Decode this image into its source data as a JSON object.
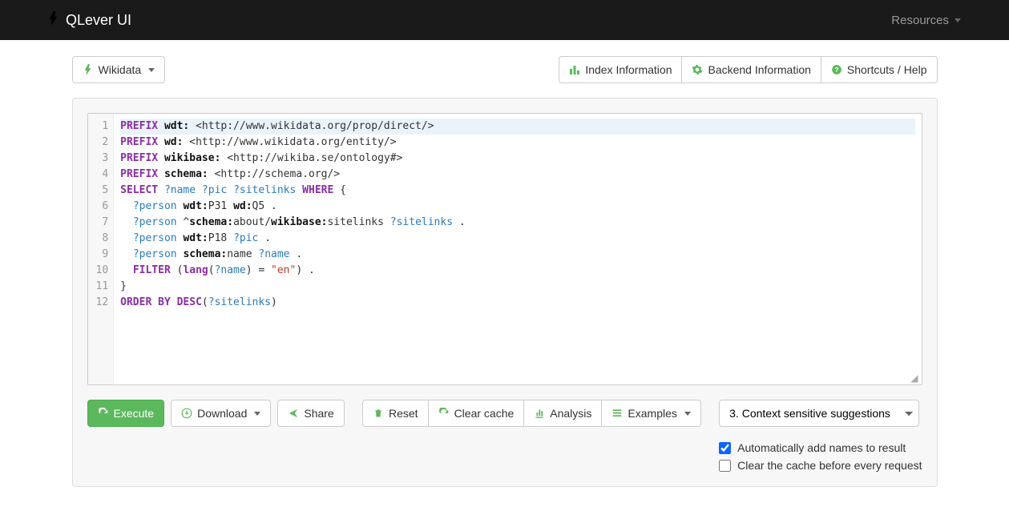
{
  "nav": {
    "brand": "QLever UI",
    "resources": "Resources"
  },
  "toolbar": {
    "dataset_label": "Wikidata",
    "index_info": "Index Information",
    "backend_info": "Backend Information",
    "shortcuts": "Shortcuts / Help"
  },
  "code": {
    "lines": [
      [
        {
          "t": "kw",
          "v": "PREFIX"
        },
        {
          "t": "txt",
          "v": " "
        },
        {
          "t": "pfx",
          "v": "wdt:"
        },
        {
          "t": "txt",
          "v": " <http://www.wikidata.org/prop/direct/>"
        }
      ],
      [
        {
          "t": "kw",
          "v": "PREFIX"
        },
        {
          "t": "txt",
          "v": " "
        },
        {
          "t": "pfx",
          "v": "wd:"
        },
        {
          "t": "txt",
          "v": " <http://www.wikidata.org/entity/>"
        }
      ],
      [
        {
          "t": "kw",
          "v": "PREFIX"
        },
        {
          "t": "txt",
          "v": " "
        },
        {
          "t": "pfx",
          "v": "wikibase:"
        },
        {
          "t": "txt",
          "v": " <http://wikiba.se/ontology#>"
        }
      ],
      [
        {
          "t": "kw",
          "v": "PREFIX"
        },
        {
          "t": "txt",
          "v": " "
        },
        {
          "t": "pfx",
          "v": "schema:"
        },
        {
          "t": "txt",
          "v": " <http://schema.org/>"
        }
      ],
      [
        {
          "t": "kw",
          "v": "SELECT"
        },
        {
          "t": "txt",
          "v": " "
        },
        {
          "t": "var",
          "v": "?name"
        },
        {
          "t": "txt",
          "v": " "
        },
        {
          "t": "var",
          "v": "?pic"
        },
        {
          "t": "txt",
          "v": " "
        },
        {
          "t": "var",
          "v": "?sitelinks"
        },
        {
          "t": "txt",
          "v": " "
        },
        {
          "t": "kw",
          "v": "WHERE"
        },
        {
          "t": "txt",
          "v": " {"
        }
      ],
      [
        {
          "t": "txt",
          "v": "  "
        },
        {
          "t": "var",
          "v": "?person"
        },
        {
          "t": "txt",
          "v": " "
        },
        {
          "t": "pfx",
          "v": "wdt:"
        },
        {
          "t": "txt",
          "v": "P31 "
        },
        {
          "t": "pfx",
          "v": "wd:"
        },
        {
          "t": "txt",
          "v": "Q5 ."
        }
      ],
      [
        {
          "t": "txt",
          "v": "  "
        },
        {
          "t": "var",
          "v": "?person"
        },
        {
          "t": "txt",
          "v": " ^"
        },
        {
          "t": "pfx",
          "v": "schema:"
        },
        {
          "t": "txt",
          "v": "about/"
        },
        {
          "t": "pfx",
          "v": "wikibase:"
        },
        {
          "t": "txt",
          "v": "sitelinks "
        },
        {
          "t": "var",
          "v": "?sitelinks"
        },
        {
          "t": "txt",
          "v": " ."
        }
      ],
      [
        {
          "t": "txt",
          "v": "  "
        },
        {
          "t": "var",
          "v": "?person"
        },
        {
          "t": "txt",
          "v": " "
        },
        {
          "t": "pfx",
          "v": "wdt:"
        },
        {
          "t": "txt",
          "v": "P18 "
        },
        {
          "t": "var",
          "v": "?pic"
        },
        {
          "t": "txt",
          "v": " ."
        }
      ],
      [
        {
          "t": "txt",
          "v": "  "
        },
        {
          "t": "var",
          "v": "?person"
        },
        {
          "t": "txt",
          "v": " "
        },
        {
          "t": "pfx",
          "v": "schema:"
        },
        {
          "t": "txt",
          "v": "name "
        },
        {
          "t": "var",
          "v": "?name"
        },
        {
          "t": "txt",
          "v": " ."
        }
      ],
      [
        {
          "t": "txt",
          "v": "  "
        },
        {
          "t": "kw",
          "v": "FILTER"
        },
        {
          "t": "txt",
          "v": " ("
        },
        {
          "t": "fn",
          "v": "lang"
        },
        {
          "t": "txt",
          "v": "("
        },
        {
          "t": "var",
          "v": "?name"
        },
        {
          "t": "txt",
          "v": ") = "
        },
        {
          "t": "str",
          "v": "\"en\""
        },
        {
          "t": "txt",
          "v": ") ."
        }
      ],
      [
        {
          "t": "txt",
          "v": "}"
        }
      ],
      [
        {
          "t": "kw",
          "v": "ORDER BY"
        },
        {
          "t": "txt",
          "v": " "
        },
        {
          "t": "kw",
          "v": "DESC"
        },
        {
          "t": "txt",
          "v": "("
        },
        {
          "t": "var",
          "v": "?sitelinks"
        },
        {
          "t": "txt",
          "v": ")"
        }
      ]
    ]
  },
  "actions": {
    "execute": "Execute",
    "download": "Download",
    "share": "Share",
    "reset": "Reset",
    "clear_cache": "Clear cache",
    "analysis": "Analysis",
    "examples": "Examples",
    "suggest_select": "3. Context sensitive suggestions",
    "auto_names": "Automatically add names to result",
    "clear_before": "Clear the cache before every request"
  }
}
